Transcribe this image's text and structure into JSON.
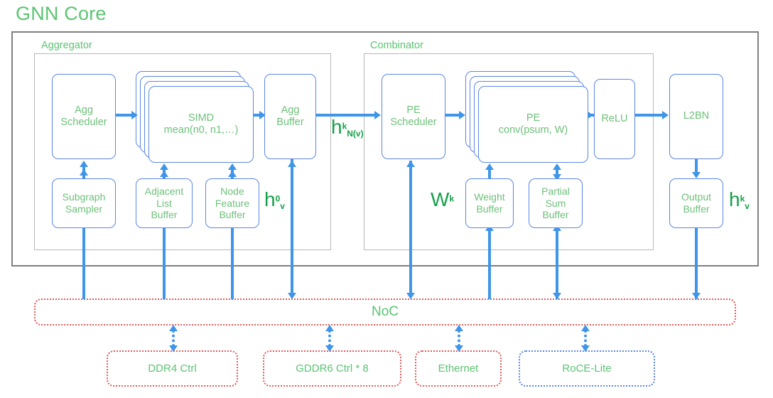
{
  "title": "GNN Core",
  "colors": {
    "accent_green": "#5bc472",
    "block_text_green": "#6ec07a",
    "math_green": "#15a04a",
    "block_border_blue": "#5b86e5",
    "arrow_blue": "#3f95e8",
    "dotted_red": "#e05c5c",
    "frame_gray": "#7f7f7f",
    "inner_frame_gray": "#b7b7b7"
  },
  "groups": {
    "aggregator": {
      "label": "Aggregator"
    },
    "combinator": {
      "label": "Combinator"
    }
  },
  "blocks": {
    "agg_scheduler": {
      "line1": "Agg",
      "line2": "Scheduler"
    },
    "simd": {
      "line1": "SIMD",
      "line2": "mean(n0, n1,…)",
      "stack_count": 4
    },
    "agg_buffer": {
      "line1": "Agg",
      "line2": "Buffer"
    },
    "subgraph_sampler": {
      "line1": "Subgraph",
      "line2": "Sampler"
    },
    "adjacent_list_buffer": {
      "line1": "Adjacent",
      "line2": "List",
      "line3": "Buffer"
    },
    "node_feature_buffer": {
      "line1": "Node",
      "line2": "Feature",
      "line3": "Buffer"
    },
    "pe_scheduler": {
      "line1": "PE",
      "line2": "Scheduler"
    },
    "pe": {
      "line1": "PE",
      "line2": "conv(psum, W)",
      "stack_count": 4
    },
    "relu": {
      "line1": "ReLU"
    },
    "l2bn": {
      "line1": "L2BN"
    },
    "weight_buffer": {
      "line1": "Weight",
      "line2": "Buffer"
    },
    "partial_sum_buffer": {
      "line1": "Partial",
      "line2": "Sum",
      "line3": "Buffer"
    },
    "output_buffer": {
      "line1": "Output",
      "line2": "Buffer"
    }
  },
  "math_labels": {
    "h_n_v": {
      "base": "h",
      "sup": "k",
      "sub": "N(v)"
    },
    "h0_v": {
      "base": "h",
      "sup": "0",
      "sub": "v"
    },
    "w_k": {
      "base": "W",
      "sup": "k",
      "sub": ""
    },
    "h_k_v": {
      "base": "h",
      "sup": "k",
      "sub": "v"
    }
  },
  "noc": {
    "label": "NoC",
    "border_style": "dotted",
    "border_color": "#e05c5c"
  },
  "peripherals": [
    {
      "label": "DDR4 Ctrl",
      "border_color": "#e05c5c"
    },
    {
      "label": "GDDR6 Ctrl * 8",
      "border_color": "#e05c5c"
    },
    {
      "label": "Ethernet",
      "border_color": "#e05c5c"
    },
    {
      "label": "RoCE-Lite",
      "border_color": "#5b86e5"
    }
  ]
}
